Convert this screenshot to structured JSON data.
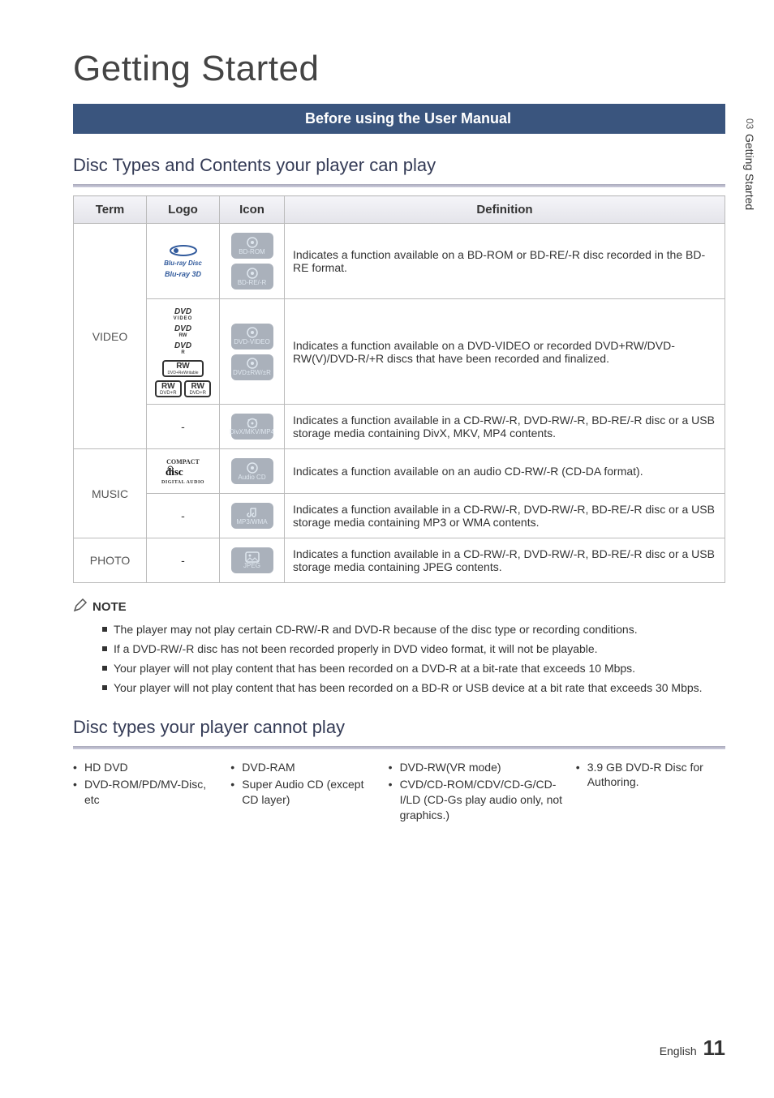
{
  "heading_main": "Getting Started",
  "banner": "Before using the User Manual",
  "section1_heading": "Disc Types and Contents your player can play",
  "side_tab": {
    "number": "03",
    "label": "Getting Started"
  },
  "table": {
    "headers": {
      "term": "Term",
      "logo": "Logo",
      "icon": "Icon",
      "definition": "Definition"
    },
    "terms": {
      "video": "VIDEO",
      "music": "MUSIC",
      "photo": "PHOTO"
    },
    "logos": {
      "bluray": "Blu-ray Disc",
      "bluray3d": "Blu-ray 3D",
      "dvd_video": "DVD VIDEO",
      "dvd_rw": "DVD RW",
      "dvd_r": "DVD R",
      "rw_rewritable": "RW DVD+ReWritable",
      "rw_plus_r": "RW DVD+R",
      "rw_plus_r2": "RW DVD+R",
      "compact_disc": "COMPACT disc DIGITAL AUDIO"
    },
    "dash": "-",
    "icons": {
      "bd_rom": "BD-ROM",
      "bd_re_r": "BD-RE/-R",
      "dvd_video": "DVD-VIDEO",
      "dvd_rw_r": "DVD±RW/±R",
      "divx": "DivX/MKV/MP4",
      "audio_cd": "Audio CD",
      "mp3": "MP3/WMA",
      "jpeg": "JPEG"
    },
    "defs": {
      "bd": "Indicates a function available on a BD-ROM or BD-RE/-R disc recorded in the BD-RE format.",
      "dvd": "Indicates a function available on a DVD-VIDEO or recorded DVD+RW/DVD-RW(V)/DVD-R/+R discs that have been recorded and finalized.",
      "divx": "Indicates a function available in a CD-RW/-R, DVD-RW/-R, BD-RE/-R disc or a USB storage media containing DivX, MKV, MP4 contents.",
      "audio_cd": "Indicates a function available on an audio CD-RW/-R (CD-DA format).",
      "mp3": "Indicates a function available in a CD-RW/-R, DVD-RW/-R, BD-RE/-R disc or a USB storage media containing MP3 or WMA contents.",
      "jpeg": "Indicates a function available in a CD-RW/-R, DVD-RW/-R, BD-RE/-R disc or a USB storage media containing JPEG contents."
    }
  },
  "note_label": "NOTE",
  "notes": [
    "The player may not play certain CD-RW/-R and DVD-R because of the disc type or recording conditions.",
    "If a DVD-RW/-R disc has not been recorded properly in DVD video format, it will not be playable.",
    "Your player will not play content that has been recorded on a DVD-R at a bit-rate that exceeds 10 Mbps.",
    "Your player will not play content that has been recorded on a BD-R or USB device at a bit rate that exceeds 30 Mbps."
  ],
  "section2_heading": "Disc types your player cannot play",
  "cannot": {
    "col1": [
      "HD DVD",
      "DVD-ROM/PD/MV-Disc, etc"
    ],
    "col2": [
      "DVD-RAM",
      "Super Audio CD (except CD layer)"
    ],
    "col3": [
      "DVD-RW(VR mode)",
      "CVD/CD-ROM/CDV/CD-G/CD-I/LD (CD-Gs play audio only, not graphics.)"
    ],
    "col4": [
      "3.9 GB DVD-R Disc for Authoring."
    ]
  },
  "footer": {
    "lang": "English",
    "page": "11"
  }
}
